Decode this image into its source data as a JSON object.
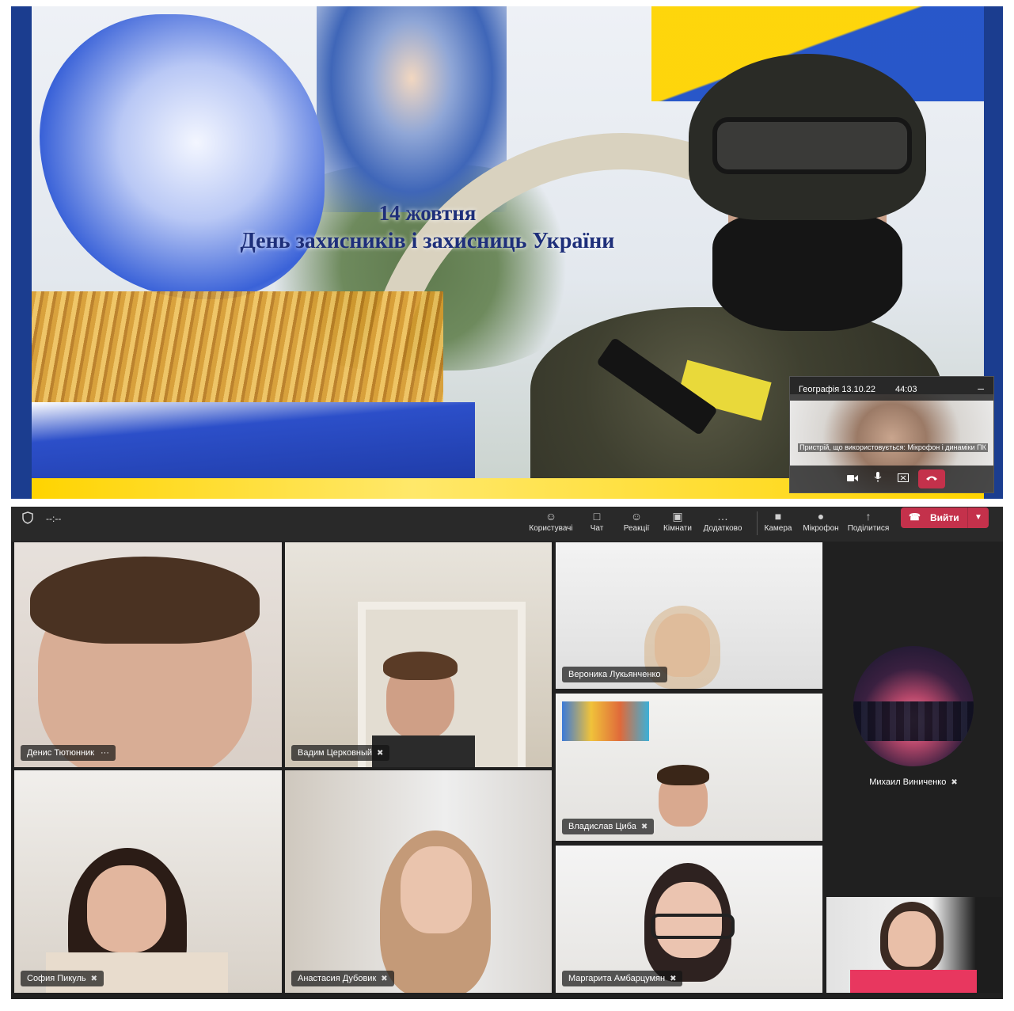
{
  "slide": {
    "title_line1": "14 жовтня",
    "title_line2": "День захисників і захисниць України"
  },
  "mini_window": {
    "title": "Географія 13.10.22",
    "time": "44:03",
    "minimize": "–",
    "device_note": "Пристрій, що використовується: Мікрофон і динаміки ПК",
    "controls": [
      "video-icon",
      "mic-icon",
      "share-icon",
      "hang-up-icon"
    ]
  },
  "toolbar": {
    "timer": "--:--",
    "items": [
      {
        "label": "Користувачі",
        "icon": "people-icon"
      },
      {
        "label": "Чат",
        "icon": "chat-icon"
      },
      {
        "label": "Реакції",
        "icon": "reactions-icon"
      },
      {
        "label": "Кімнати",
        "icon": "rooms-icon"
      },
      {
        "label": "Додатково",
        "icon": "more-icon"
      },
      {
        "label": "Камера",
        "icon": "camera-icon"
      },
      {
        "label": "Мікрофон",
        "icon": "microphone-icon"
      },
      {
        "label": "Поділитися",
        "icon": "share-icon"
      }
    ],
    "leave_label": "Вийти"
  },
  "participants": [
    {
      "name": "Денис Тютюнник",
      "muted": false,
      "more": "···"
    },
    {
      "name": "Вадим Церковный",
      "muted": true
    },
    {
      "name": "Вероника Лукьянченко",
      "muted": false
    },
    {
      "name": "Владислав Циба",
      "muted": true
    },
    {
      "name": "София Пикуль",
      "muted": true
    },
    {
      "name": "Анастасия Дубовик",
      "muted": true
    },
    {
      "name": "Маргарита Амбарцумян",
      "muted": true
    },
    {
      "name": "Михаил Виниченко",
      "muted": true
    }
  ],
  "colors": {
    "leave": "#c4314b",
    "toolbar_bg": "#292929",
    "stage_bg": "#202020",
    "slide_border": "#1b3d8f"
  }
}
